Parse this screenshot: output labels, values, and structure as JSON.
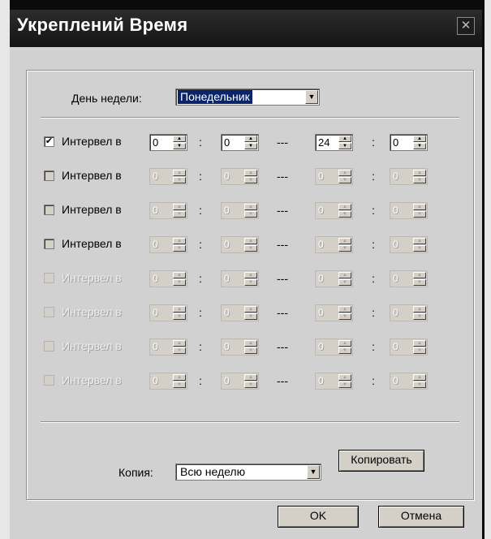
{
  "window": {
    "title": "Укреплений Время",
    "close_symbol": "✕"
  },
  "day": {
    "label": "День недели:",
    "value": "Понедельник"
  },
  "dropdown_arrow": "▼",
  "interval_label": "Интервел в",
  "colon": ":",
  "dash": "---",
  "check_mark": "✔",
  "spin_up": "▲",
  "spin_down": "▼",
  "rows": [
    {
      "checked": true,
      "enabled": true,
      "dimmed": false,
      "start_h": "0",
      "start_m": "0",
      "end_h": "24",
      "end_m": "0"
    },
    {
      "checked": false,
      "enabled": false,
      "dimmed": false,
      "start_h": "0",
      "start_m": "0",
      "end_h": "0",
      "end_m": "0"
    },
    {
      "checked": false,
      "enabled": false,
      "dimmed": false,
      "start_h": "0",
      "start_m": "0",
      "end_h": "0",
      "end_m": "0"
    },
    {
      "checked": false,
      "enabled": false,
      "dimmed": false,
      "start_h": "0",
      "start_m": "0",
      "end_h": "0",
      "end_m": "0"
    },
    {
      "checked": false,
      "enabled": false,
      "dimmed": true,
      "start_h": "0",
      "start_m": "0",
      "end_h": "0",
      "end_m": "0"
    },
    {
      "checked": false,
      "enabled": false,
      "dimmed": true,
      "start_h": "0",
      "start_m": "0",
      "end_h": "0",
      "end_m": "0"
    },
    {
      "checked": false,
      "enabled": false,
      "dimmed": true,
      "start_h": "0",
      "start_m": "0",
      "end_h": "0",
      "end_m": "0"
    },
    {
      "checked": false,
      "enabled": false,
      "dimmed": true,
      "start_h": "0",
      "start_m": "0",
      "end_h": "0",
      "end_m": "0"
    }
  ],
  "copy": {
    "label": "Копия:",
    "value": "Всю неделю",
    "button": "Копировать"
  },
  "footer": {
    "ok": "OK",
    "cancel": "Отмена"
  }
}
